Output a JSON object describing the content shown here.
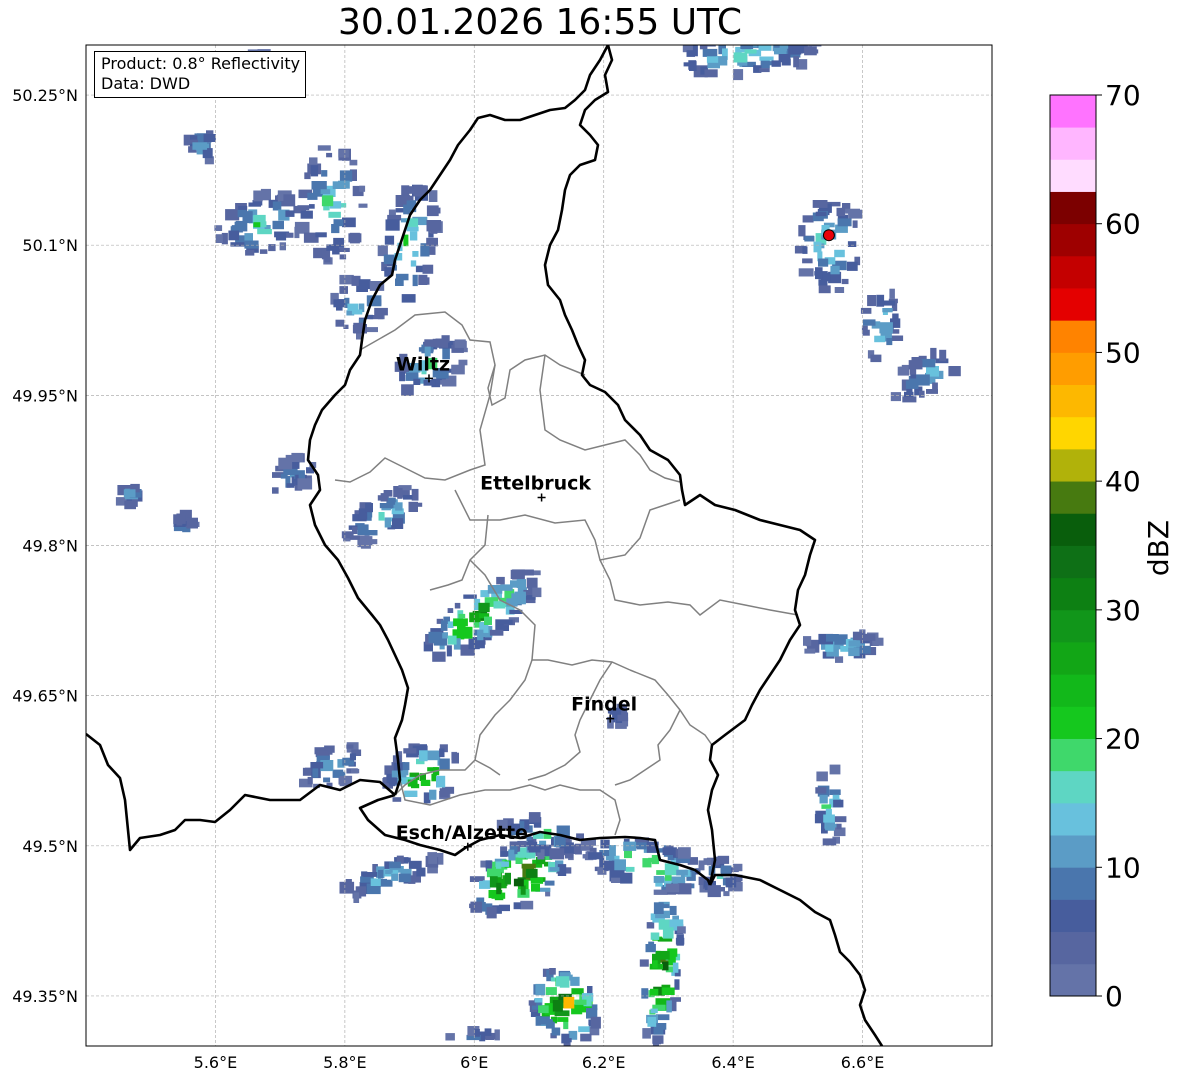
{
  "title": "30.01.2026 16:55 UTC",
  "info": {
    "product": "Product: 0.8° Reflectivity",
    "data": "Data: DWD"
  },
  "map": {
    "lon_range": [
      5.4,
      6.8
    ],
    "lat_range": [
      49.3,
      50.3
    ],
    "lat_ticks": [
      {
        "value": 50.25,
        "label": "50.25°N"
      },
      {
        "value": 50.1,
        "label": "50.1°N"
      },
      {
        "value": 49.95,
        "label": "49.95°N"
      },
      {
        "value": 49.8,
        "label": "49.8°N"
      },
      {
        "value": 49.65,
        "label": "49.65°N"
      },
      {
        "value": 49.5,
        "label": "49.5°N"
      },
      {
        "value": 49.35,
        "label": "49.35°N"
      }
    ],
    "lon_ticks": [
      {
        "value": 5.6,
        "label": "5.6°E"
      },
      {
        "value": 5.8,
        "label": "5.8°E"
      },
      {
        "value": 6.0,
        "label": "6°E"
      },
      {
        "value": 6.2,
        "label": "6.2°E"
      },
      {
        "value": 6.4,
        "label": "6.4°E"
      },
      {
        "value": 6.6,
        "label": "6.6°E"
      }
    ],
    "cities": [
      {
        "name": "Wiltz",
        "lon": 5.93,
        "lat": 49.967
      },
      {
        "name": "Ettelbruck",
        "lon": 6.104,
        "lat": 49.848
      },
      {
        "name": "Findel",
        "lon": 6.21,
        "lat": 49.627
      },
      {
        "name": "Esch/Alzette",
        "lon": 5.99,
        "lat": 49.499
      }
    ],
    "radar_site": {
      "lon": 6.548,
      "lat": 50.11,
      "color": "#e8000b"
    },
    "grid": true
  },
  "colorbar": {
    "label": "dBZ",
    "ticks": [
      0,
      10,
      20,
      30,
      40,
      50,
      60,
      70
    ],
    "range": [
      0,
      70
    ],
    "step": 2.5,
    "colors": [
      "#6473a8",
      "#5766a0",
      "#475d9d",
      "#4a76ad",
      "#5b9cc6",
      "#68c1dd",
      "#5ed6c3",
      "#3fd86b",
      "#15c81e",
      "#12b81a",
      "#12a616",
      "#11961a",
      "#0d8013",
      "#0e7016",
      "#095e0c",
      "#477a10",
      "#b1b20a",
      "#ffd600",
      "#fdb800",
      "#ff9d00",
      "#ff8300",
      "#e40000",
      "#c40000",
      "#9e0000",
      "#7c0000",
      "#ffdcff",
      "#ffb6ff",
      "#ff73ff",
      "#ea38ea"
    ]
  },
  "echo_cells": [
    {
      "lon": 5.67,
      "lat": 50.12,
      "rx": 0.07,
      "ry": 0.03,
      "angle": -20,
      "n": 18,
      "max": 8
    },
    {
      "lon": 5.78,
      "lat": 50.14,
      "rx": 0.05,
      "ry": 0.06,
      "angle": 0,
      "n": 18,
      "max": 8
    },
    {
      "lon": 5.9,
      "lat": 50.1,
      "rx": 0.04,
      "ry": 0.07,
      "angle": 10,
      "n": 18,
      "max": 9
    },
    {
      "lon": 5.82,
      "lat": 50.04,
      "rx": 0.04,
      "ry": 0.03,
      "angle": 0,
      "n": 10,
      "max": 7
    },
    {
      "lon": 5.68,
      "lat": 50.28,
      "rx": 0.04,
      "ry": 0.01,
      "angle": 20,
      "n": 8,
      "max": 6
    },
    {
      "lon": 5.58,
      "lat": 50.2,
      "rx": 0.02,
      "ry": 0.02,
      "angle": 0,
      "n": 6,
      "max": 6
    },
    {
      "lon": 5.93,
      "lat": 49.98,
      "rx": 0.06,
      "ry": 0.025,
      "angle": -30,
      "n": 14,
      "max": 8
    },
    {
      "lon": 5.72,
      "lat": 49.87,
      "rx": 0.04,
      "ry": 0.015,
      "angle": -35,
      "n": 8,
      "max": 6
    },
    {
      "lon": 5.86,
      "lat": 49.83,
      "rx": 0.07,
      "ry": 0.02,
      "angle": -30,
      "n": 14,
      "max": 7
    },
    {
      "lon": 6.01,
      "lat": 49.73,
      "rx": 0.11,
      "ry": 0.025,
      "angle": -35,
      "n": 26,
      "max": 13
    },
    {
      "lon": 5.78,
      "lat": 49.58,
      "rx": 0.05,
      "ry": 0.02,
      "angle": -25,
      "n": 12,
      "max": 7
    },
    {
      "lon": 5.92,
      "lat": 49.57,
      "rx": 0.06,
      "ry": 0.03,
      "angle": -30,
      "n": 16,
      "max": 13
    },
    {
      "lon": 5.87,
      "lat": 49.47,
      "rx": 0.08,
      "ry": 0.015,
      "angle": -20,
      "n": 14,
      "max": 7
    },
    {
      "lon": 6.07,
      "lat": 49.47,
      "rx": 0.09,
      "ry": 0.03,
      "angle": -30,
      "n": 28,
      "max": 20
    },
    {
      "lon": 6.11,
      "lat": 49.51,
      "rx": 0.07,
      "ry": 0.02,
      "angle": 10,
      "n": 12,
      "max": 8
    },
    {
      "lon": 6.27,
      "lat": 49.48,
      "rx": 0.1,
      "ry": 0.025,
      "angle": 15,
      "n": 22,
      "max": 12
    },
    {
      "lon": 6.38,
      "lat": 49.47,
      "rx": 0.03,
      "ry": 0.02,
      "angle": 0,
      "n": 8,
      "max": 7
    },
    {
      "lon": 6.29,
      "lat": 49.38,
      "rx": 0.03,
      "ry": 0.08,
      "angle": 5,
      "n": 22,
      "max": 18
    },
    {
      "lon": 6.14,
      "lat": 49.34,
      "rx": 0.05,
      "ry": 0.04,
      "angle": -35,
      "n": 20,
      "max": 20
    },
    {
      "lon": 6.42,
      "lat": 50.29,
      "rx": 0.12,
      "ry": 0.02,
      "angle": -5,
      "n": 20,
      "max": 8
    },
    {
      "lon": 6.55,
      "lat": 50.1,
      "rx": 0.05,
      "ry": 0.05,
      "angle": 0,
      "n": 16,
      "max": 8
    },
    {
      "lon": 6.63,
      "lat": 50.02,
      "rx": 0.03,
      "ry": 0.04,
      "angle": 0,
      "n": 8,
      "max": 7
    },
    {
      "lon": 6.7,
      "lat": 49.97,
      "rx": 0.06,
      "ry": 0.02,
      "angle": -35,
      "n": 10,
      "max": 6
    },
    {
      "lon": 6.57,
      "lat": 49.7,
      "rx": 0.06,
      "ry": 0.015,
      "angle": 0,
      "n": 10,
      "max": 7
    },
    {
      "lon": 6.55,
      "lat": 49.54,
      "rx": 0.02,
      "ry": 0.04,
      "angle": 0,
      "n": 8,
      "max": 9
    },
    {
      "lon": 6.22,
      "lat": 49.63,
      "rx": 0.015,
      "ry": 0.01,
      "angle": 0,
      "n": 4,
      "max": 4
    },
    {
      "lon": 6.0,
      "lat": 49.31,
      "rx": 0.04,
      "ry": 0.005,
      "angle": 0,
      "n": 3,
      "max": 5
    },
    {
      "lon": 5.47,
      "lat": 49.85,
      "rx": 0.02,
      "ry": 0.01,
      "angle": -45,
      "n": 4,
      "max": 5
    },
    {
      "lon": 5.55,
      "lat": 49.82,
      "rx": 0.02,
      "ry": 0.01,
      "angle": -45,
      "n": 4,
      "max": 5
    }
  ]
}
